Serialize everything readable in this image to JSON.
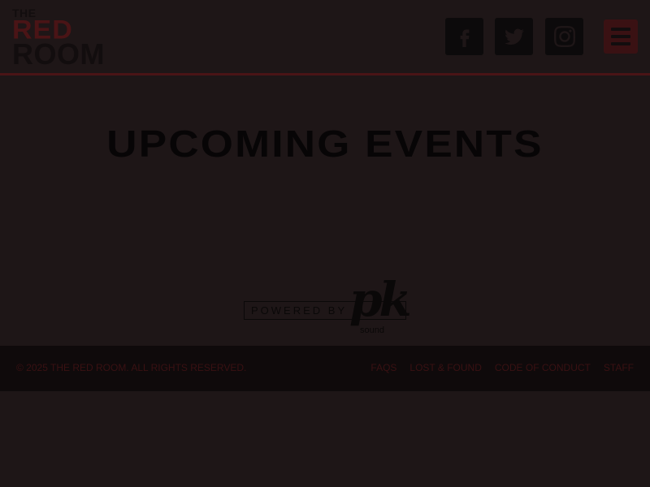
{
  "header": {
    "logo": {
      "line1": "THE",
      "line2": "RED",
      "line3": "ROOM"
    },
    "social": [
      {
        "name": "facebook-icon"
      },
      {
        "name": "twitter-icon"
      },
      {
        "name": "instagram-icon"
      }
    ],
    "menu_icon": "hamburger-menu-icon"
  },
  "main": {
    "title": "UPCOMING EVENTS"
  },
  "sponsor": {
    "powered_by": "POWERED BY",
    "brand": "pk",
    "brand_sub": "sound"
  },
  "footer": {
    "copyright": "© 2025 THE RED ROOM. ALL RIGHTS RESERVED.",
    "links": [
      "FAQS",
      "LOST & FOUND",
      "CODE OF CONDUCT",
      "STAFF"
    ]
  },
  "colors": {
    "background": "#1e1617",
    "accent_red": "#4a1416",
    "footer_bg": "#0f0a0b"
  }
}
